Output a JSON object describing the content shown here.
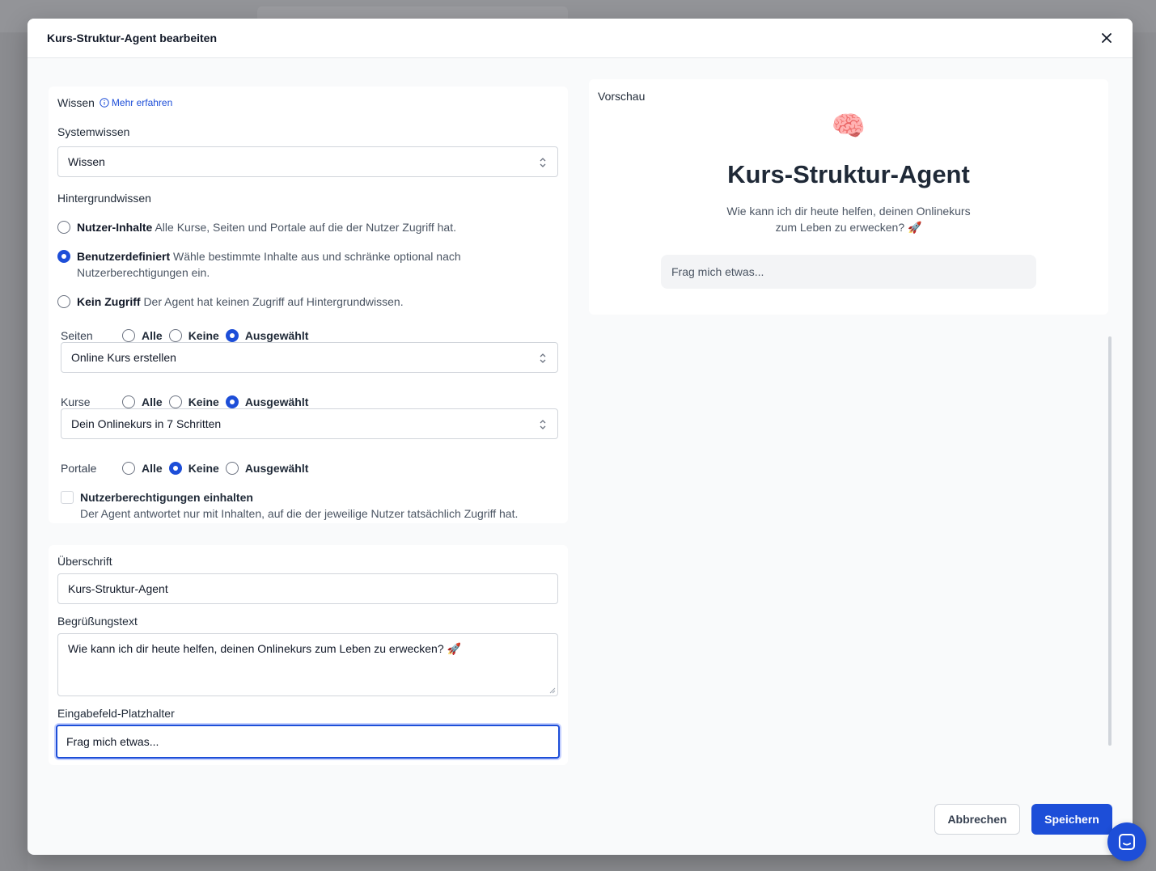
{
  "modal": {
    "title": "Kurs-Struktur-Agent bearbeiten"
  },
  "knowledge": {
    "section_label": "Wissen",
    "learn_more": "Mehr erfahren",
    "system_knowledge_label": "Systemwissen",
    "system_knowledge_value": "Wissen",
    "background_label": "Hintergrundwissen",
    "options": [
      {
        "title": "Nutzer-Inhalte",
        "desc": "Alle Kurse, Seiten und Portale auf die der Nutzer Zugriff hat.",
        "checked": false
      },
      {
        "title": "Benutzerdefiniert",
        "desc": "Wähle bestimmte Inhalte aus und schränke optional nach Nutzerberechtigungen ein.",
        "checked": true
      },
      {
        "title": "Kein Zugriff",
        "desc": "Der Agent hat keinen Zugriff auf Hintergrundwissen.",
        "checked": false
      }
    ],
    "scope_options": {
      "all": "Alle",
      "none": "Keine",
      "selected": "Ausgewählt"
    },
    "pages": {
      "label": "Seiten",
      "selection": "selected",
      "value": "Online Kurs erstellen"
    },
    "courses": {
      "label": "Kurse",
      "selection": "selected",
      "value": "Dein Onlinekurs in 7 Schritten"
    },
    "portals": {
      "label": "Portale",
      "selection": "none"
    },
    "permissions": {
      "label": "Nutzerberechtigungen einhalten",
      "desc": "Der Agent antwortet nur mit Inhalten, auf die der jeweilige Nutzer tatsächlich Zugriff hat.",
      "checked": false
    }
  },
  "texts": {
    "heading_label": "Überschrift",
    "heading_value": "Kurs-Struktur-Agent",
    "greeting_label": "Begrüßungstext",
    "greeting_value": "Wie kann ich dir heute helfen, deinen Onlinekurs zum Leben zu erwecken? 🚀",
    "placeholder_label": "Eingabefeld-Platzhalter",
    "placeholder_value": "Frag mich etwas..."
  },
  "preview": {
    "label": "Vorschau",
    "emoji": "🧠",
    "title": "Kurs-Struktur-Agent",
    "greeting": "Wie kann ich dir heute helfen, deinen Onlinekurs zum Leben zu erwecken? 🚀",
    "input_placeholder": "Frag mich etwas..."
  },
  "footer": {
    "cancel": "Abbrechen",
    "save": "Speichern"
  },
  "colors": {
    "accent": "#1d4ed8",
    "overlay": "#8d8e92"
  }
}
